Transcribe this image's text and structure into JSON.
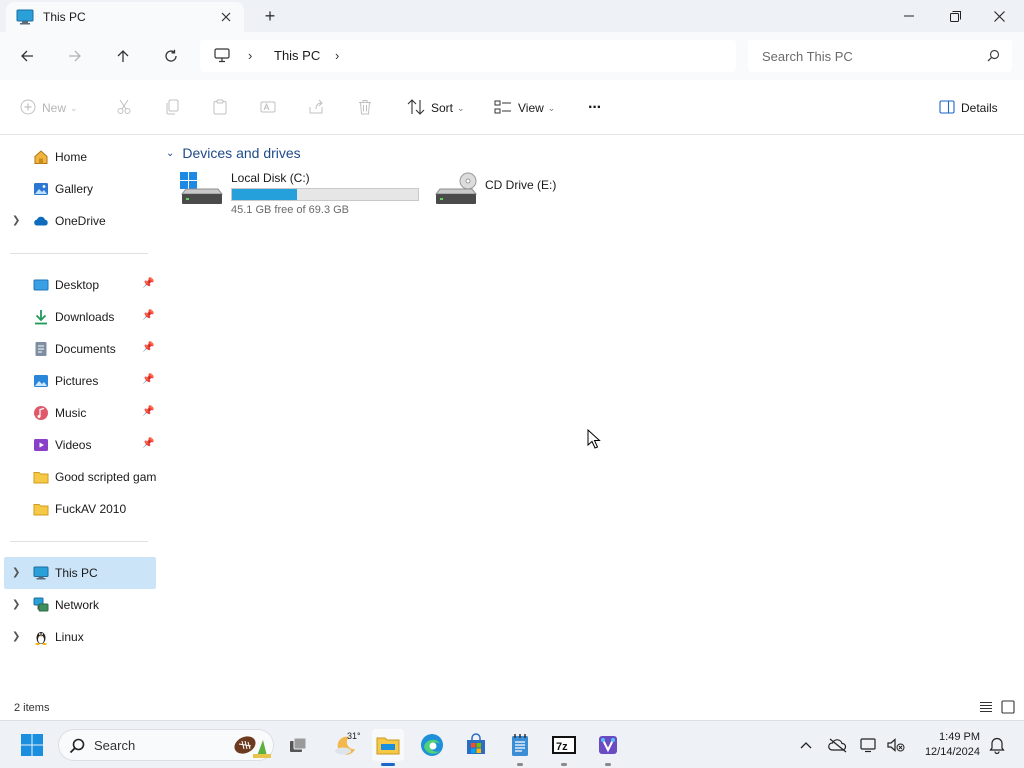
{
  "window": {
    "tab_title": "This PC",
    "new_tab_symbol": "+"
  },
  "address": {
    "crumbs": [
      "This PC"
    ],
    "separator": "›"
  },
  "search": {
    "placeholder": "Search This PC"
  },
  "commands": {
    "new_label": "New",
    "sort_label": "Sort",
    "view_label": "View",
    "more_label": "···",
    "details_label": "Details"
  },
  "sidebar": {
    "items": [
      {
        "label": "Home",
        "icon": "home-icon"
      },
      {
        "label": "Gallery",
        "icon": "gallery-icon"
      },
      {
        "label": "OneDrive",
        "icon": "onedrive-icon"
      },
      {
        "label": "Desktop",
        "icon": "desktop-icon",
        "pinned": true
      },
      {
        "label": "Downloads",
        "icon": "downloads-icon",
        "pinned": true
      },
      {
        "label": "Documents",
        "icon": "documents-icon",
        "pinned": true
      },
      {
        "label": "Pictures",
        "icon": "pictures-icon",
        "pinned": true
      },
      {
        "label": "Music",
        "icon": "music-icon",
        "pinned": true
      },
      {
        "label": "Videos",
        "icon": "videos-icon",
        "pinned": true
      },
      {
        "label": "Good scripted gam",
        "icon": "folder-icon"
      },
      {
        "label": "FuckAV 2010",
        "icon": "folder-icon"
      },
      {
        "label": "This PC",
        "icon": "this-pc-icon",
        "selected": true
      },
      {
        "label": "Network",
        "icon": "network-icon"
      },
      {
        "label": "Linux",
        "icon": "linux-icon"
      }
    ]
  },
  "content": {
    "group_title": "Devices and drives",
    "drives": [
      {
        "name": "Local Disk (C:)",
        "free_text": "45.1 GB free of 69.3 GB",
        "used_fraction": 0.349
      },
      {
        "name": "CD Drive (E:)"
      }
    ]
  },
  "status": {
    "item_count": "2 items"
  },
  "taskbar": {
    "search_placeholder": "Search",
    "weather_temp": "31°",
    "time": "1:49 PM",
    "date": "12/14/2024"
  },
  "colors": {
    "accent": "#26a0da",
    "selection": "#cce4f7",
    "group_header": "#1f4a8a"
  }
}
